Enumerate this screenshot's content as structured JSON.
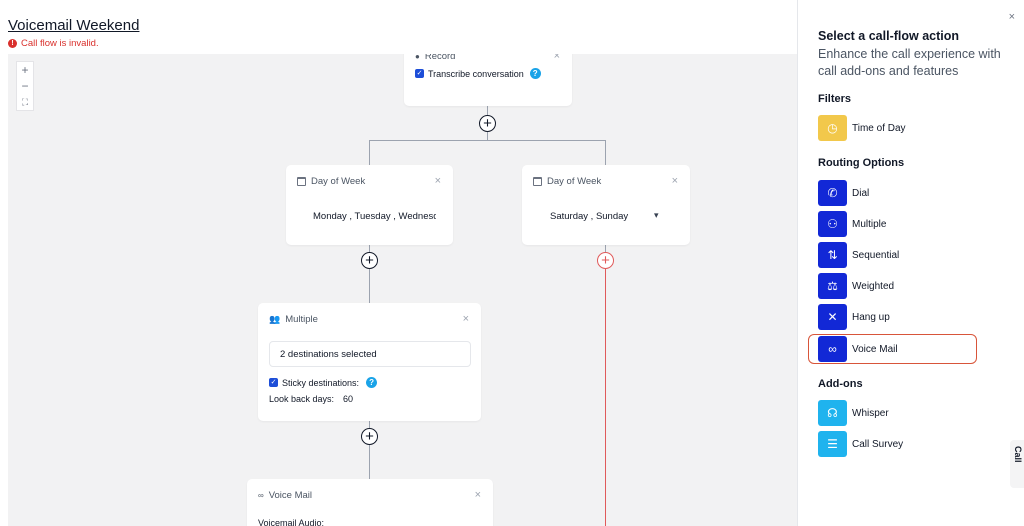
{
  "header": {
    "title": "Voicemail Weekend",
    "error_icon": "!",
    "error": "Call flow is invalid."
  },
  "canvas": {
    "zoom": {
      "in": "+",
      "out": "−",
      "fit": "⛶"
    },
    "record_node": {
      "label": "Record",
      "close": "×",
      "transcribe_label": "Transcribe conversation",
      "transcribe_checked": true,
      "help": "?"
    },
    "branch_plus": "+",
    "day_node_left": {
      "label": "Day of Week",
      "close": "×",
      "value": "Monday , Tuesday , Wednesday"
    },
    "day_node_right": {
      "label": "Day of Week",
      "close": "×",
      "value": "Saturday , Sunday",
      "caret": "▾"
    },
    "multiple_node": {
      "label": "Multiple",
      "close": "×",
      "destinations": "2 destinations selected",
      "sticky_label": "Sticky destinations:",
      "sticky_checked": true,
      "help": "?",
      "lookback_label": "Look back days:",
      "lookback_value": "60"
    },
    "voicemail_node": {
      "label": "Voice Mail",
      "close": "×",
      "audio_label": "Voicemail Audio:"
    }
  },
  "panel": {
    "close": "×",
    "title": "Select a call-flow action",
    "subtitle": "Enhance the call experience with call add-ons and features",
    "filters_heading": "Filters",
    "filters": [
      {
        "label": "Time of Day",
        "icon": "clock-icon",
        "color": "#f2c84b"
      }
    ],
    "routing_heading": "Routing Options",
    "routing": [
      {
        "label": "Dial",
        "icon": "phone-icon",
        "color": "#1228d6"
      },
      {
        "label": "Multiple",
        "icon": "users-icon",
        "color": "#1228d6"
      },
      {
        "label": "Sequential",
        "icon": "sort-arrows-icon",
        "color": "#1228d6"
      },
      {
        "label": "Weighted",
        "icon": "scale-icon",
        "color": "#1228d6"
      },
      {
        "label": "Hang up",
        "icon": "hang-up-icon",
        "color": "#1228d6"
      },
      {
        "label": "Voice Mail",
        "icon": "voicemail-icon",
        "color": "#1228d6",
        "highlighted": true
      }
    ],
    "addons_heading": "Add-ons",
    "addons": [
      {
        "label": "Whisper",
        "icon": "headset-icon",
        "color": "#1fb3ee"
      },
      {
        "label": "Call Survey",
        "icon": "survey-icon",
        "color": "#1fb3ee"
      }
    ],
    "side_tab": "Call"
  }
}
